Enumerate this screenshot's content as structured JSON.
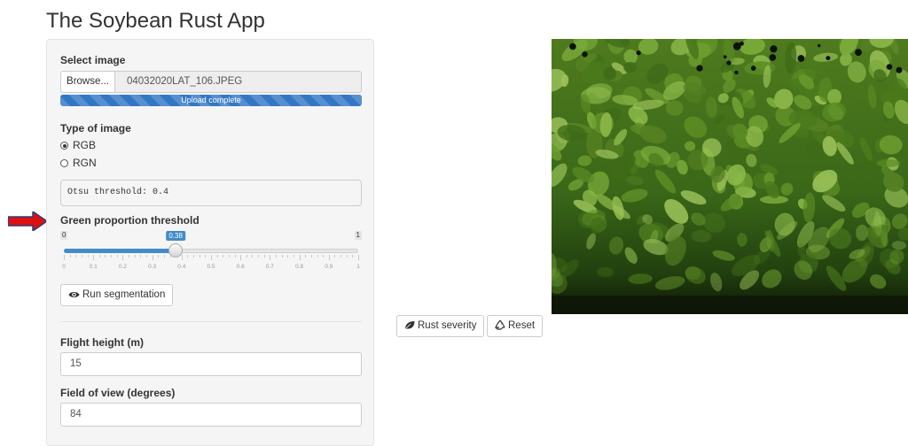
{
  "app": {
    "title": "The Soybean Rust App"
  },
  "colors": {
    "progress": "#3377c4",
    "slider_fill": "#428bca",
    "arrow": "#dd1111"
  },
  "upload": {
    "label": "Select image",
    "browse_label": "Browse...",
    "filename": "04032020LAT_106.JPEG",
    "status": "Upload complete",
    "progress": 1.0
  },
  "image_type": {
    "label": "Type of image",
    "options": [
      {
        "label": "RGB",
        "selected": true
      },
      {
        "label": "RGN",
        "selected": false
      }
    ]
  },
  "otsu": {
    "text": "Otsu threshold: 0.4"
  },
  "green_threshold": {
    "label": "Green proportion threshold",
    "min": "0",
    "max": "1",
    "value": 0.38,
    "value_label": "0.38",
    "tick_labels": [
      "0",
      "0.1",
      "0.2",
      "0.3",
      "0.4",
      "0.5",
      "0.6",
      "0.7",
      "0.8",
      "0.9",
      "1"
    ]
  },
  "buttons": {
    "run_segmentation": "Run segmentation",
    "rust_severity": "Rust severity",
    "reset": "Reset"
  },
  "flight_height": {
    "label": "Flight height (m)",
    "value": "15"
  },
  "field_of_view": {
    "label": "Field of view (degrees)",
    "value": "84"
  },
  "icons": {
    "arrow": "right-arrow-icon",
    "run_segmentation": "eye-icon",
    "rust_severity": "leaf-icon",
    "reset": "recycle-icon"
  }
}
